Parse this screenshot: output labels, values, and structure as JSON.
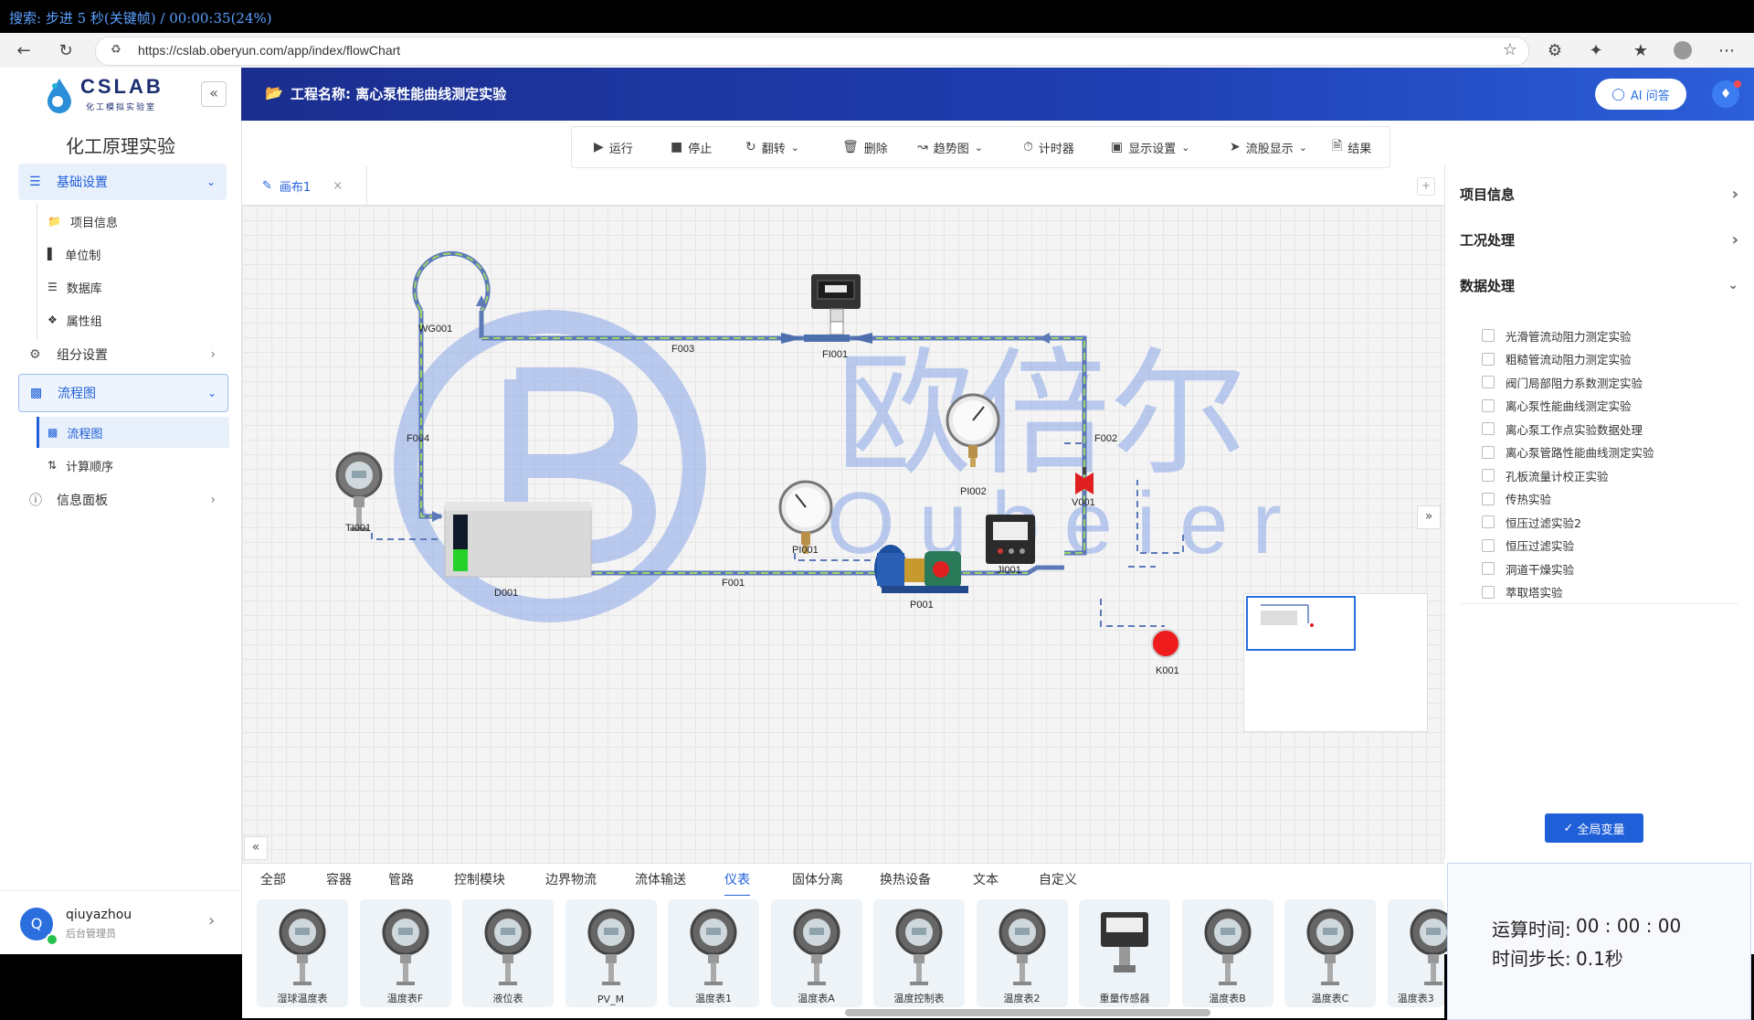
{
  "player": {
    "status": "搜索: 步进 5 秒(关键帧) / 00:00:35(24%)"
  },
  "browser": {
    "url": "https://cslab.oberyun.com/app/index/flowChart"
  },
  "app": {
    "logo_text": "CSLAB",
    "logo_subtext": "化工模拟实验室",
    "sidebar_title": "化工原理实验",
    "project_label": "工程名称: 离心泵性能曲线测定实验",
    "ai_button": "AI 问答",
    "accent_color": "#1f5fd8"
  },
  "sidebar": {
    "groups": [
      {
        "label": "基础设置",
        "icon": "sliders-icon",
        "expanded": true,
        "items": [
          {
            "label": "项目信息",
            "icon": "folder-icon"
          },
          {
            "label": "单位制",
            "icon": "ruler-icon"
          },
          {
            "label": "数据库",
            "icon": "database-icon"
          },
          {
            "label": "属性组",
            "icon": "tags-icon"
          }
        ]
      },
      {
        "label": "组分设置",
        "icon": "gear-icon",
        "expanded": false,
        "items": []
      },
      {
        "label": "流程图",
        "icon": "flow-icon",
        "expanded": true,
        "items": [
          {
            "label": "流程图",
            "icon": "flow-icon",
            "selected": true
          },
          {
            "label": "计算顺序",
            "icon": "sort-icon"
          }
        ]
      },
      {
        "label": "信息面板",
        "icon": "info-icon",
        "expanded": false,
        "items": []
      }
    ],
    "user": {
      "name": "qiuyazhou",
      "role": "后台管理员",
      "avatar_letter": "Q"
    }
  },
  "toolbar": [
    {
      "label": "运行",
      "icon": "play-icon"
    },
    {
      "label": "停止",
      "icon": "stop-icon"
    },
    {
      "label": "翻转",
      "icon": "rotate-icon",
      "dropdown": true
    },
    {
      "label": "删除",
      "icon": "trash-icon"
    },
    {
      "label": "趋势图",
      "icon": "chart-icon",
      "dropdown": true
    },
    {
      "label": "计时器",
      "icon": "stopwatch-icon"
    },
    {
      "label": "显示设置",
      "icon": "monitor-icon",
      "dropdown": true
    },
    {
      "label": "流股显示",
      "icon": "send-icon",
      "dropdown": true
    },
    {
      "label": "结果",
      "icon": "file-icon"
    }
  ],
  "canvas": {
    "tab": "画布1",
    "tab_close": "×",
    "watermark_cn": "欧倍尔",
    "watermark_en": "Oubeier",
    "labels": {
      "WG001": "WG001",
      "F003": "F003",
      "FI001": "FI001",
      "F004": "F004",
      "F002": "F002",
      "PI002": "PI002",
      "V001": "V001",
      "TI001": "TI001",
      "PI001": "PI001",
      "JI001": "JI001",
      "D001": "D001",
      "F001": "F001",
      "P001": "P001",
      "K001": "K001"
    }
  },
  "right_panel": {
    "sections": [
      {
        "label": "项目信息",
        "expanded": false
      },
      {
        "label": "工况处理",
        "expanded": false
      },
      {
        "label": "数据处理",
        "expanded": true
      }
    ],
    "experiments": [
      "光滑管流动阻力测定实验",
      "粗糙管流动阻力测定实验",
      "阀门局部阻力系数测定实验",
      "离心泵性能曲线测定实验",
      "离心泵工作点实验数据处理",
      "离心泵管路性能曲线测定实验",
      "孔板流量计校正实验",
      "传热实验",
      "恒压过滤实验2",
      "恒压过滤实验",
      "洞道干燥实验",
      "萃取塔实验"
    ],
    "global_button": "全局变量"
  },
  "timer": {
    "run_label": "运算时间:",
    "run_value": "00 : 00 : 00",
    "step_label": "时间步长:",
    "step_value": "0.1秒"
  },
  "palette": {
    "tabs": [
      "全部",
      "容器",
      "管路",
      "控制模块",
      "边界物流",
      "流体输送",
      "仪表",
      "固体分离",
      "换热设备",
      "文本",
      "自定义"
    ],
    "active_tab": "仪表",
    "items": [
      "湿球温度表",
      "温度表F",
      "液位表",
      "PV_M",
      "温度表1",
      "温度表A",
      "温度控制表",
      "温度表2",
      "重量传感器",
      "温度表B",
      "温度表C",
      "温度表3"
    ]
  }
}
